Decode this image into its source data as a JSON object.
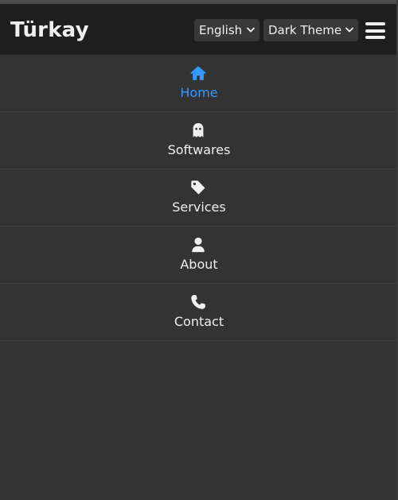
{
  "colors": {
    "accent": "#3399ff",
    "header_bg": "#1e1e1e",
    "page_bg": "#333333",
    "text": "#f0f0f0"
  },
  "header": {
    "brand": "Türkay",
    "language_select": {
      "selected": "English"
    },
    "theme_select": {
      "selected": "Dark Theme"
    },
    "menu_icon": "hamburger-menu-icon"
  },
  "nav": {
    "items": [
      {
        "label": "Home",
        "icon": "home-icon",
        "active": true
      },
      {
        "label": "Softwares",
        "icon": "ghost-icon",
        "active": false
      },
      {
        "label": "Services",
        "icon": "tag-icon",
        "active": false
      },
      {
        "label": "About",
        "icon": "user-icon",
        "active": false
      },
      {
        "label": "Contact",
        "icon": "phone-icon",
        "active": false
      }
    ]
  }
}
